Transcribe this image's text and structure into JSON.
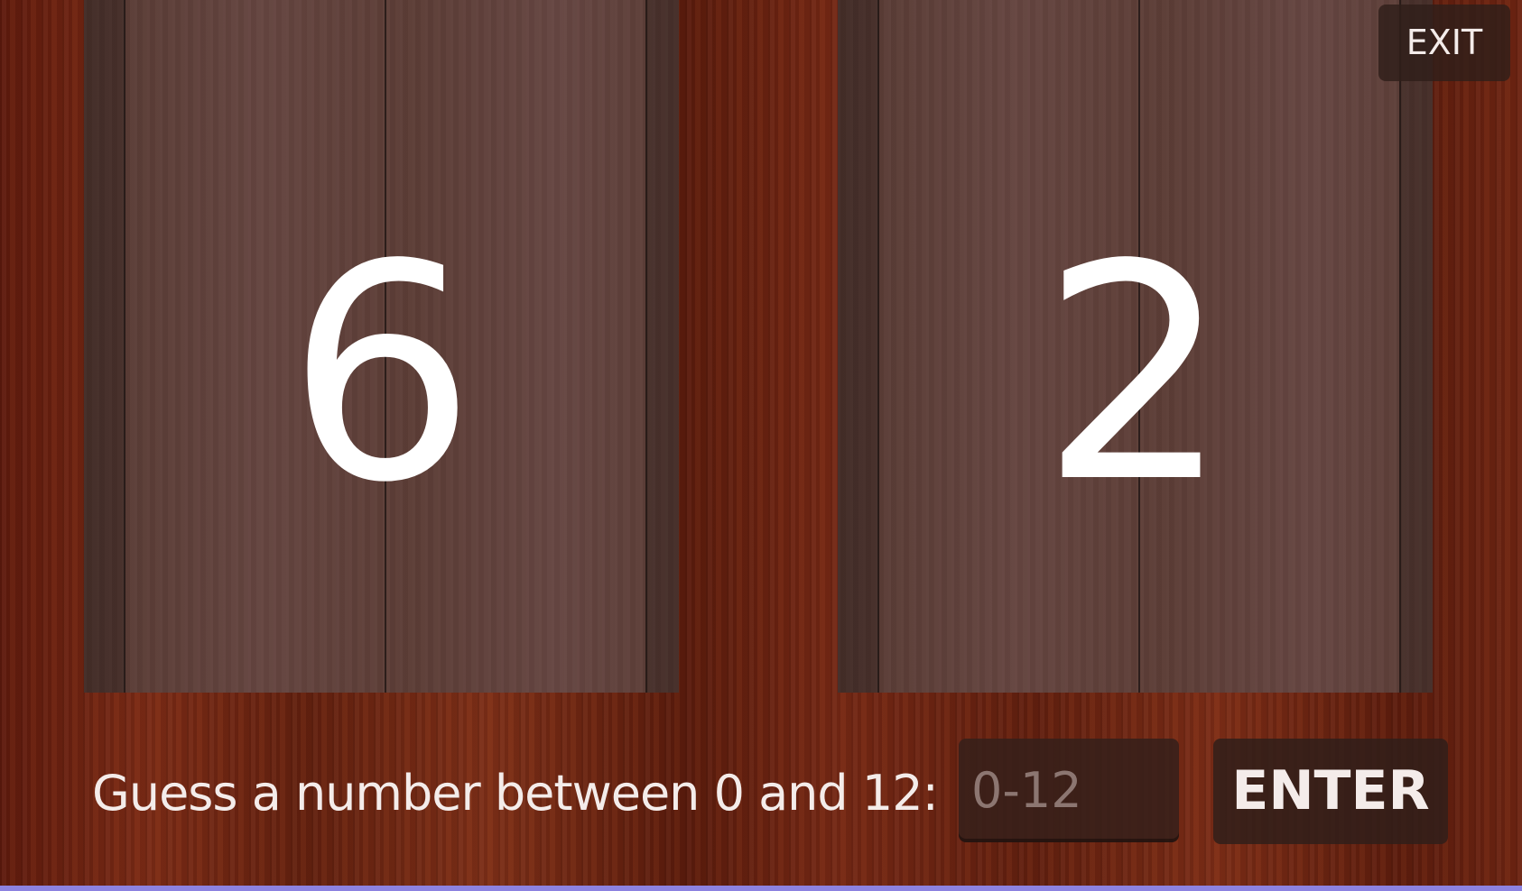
{
  "game": {
    "left_card_value": "6",
    "right_card_value": "2"
  },
  "header": {
    "exit_label": "EXIT"
  },
  "guess": {
    "prompt": "Guess a number between 0 and 12:",
    "input_value": "",
    "input_placeholder": "0-12",
    "enter_label": "ENTER"
  },
  "colors": {
    "table_wood": "#6a1f10",
    "panel_wood": "#5f4038",
    "button_bg": "#301e1a",
    "text": "#ffffff",
    "placeholder_text": "#8c7671",
    "bottom_strip": "#8c82e0"
  }
}
